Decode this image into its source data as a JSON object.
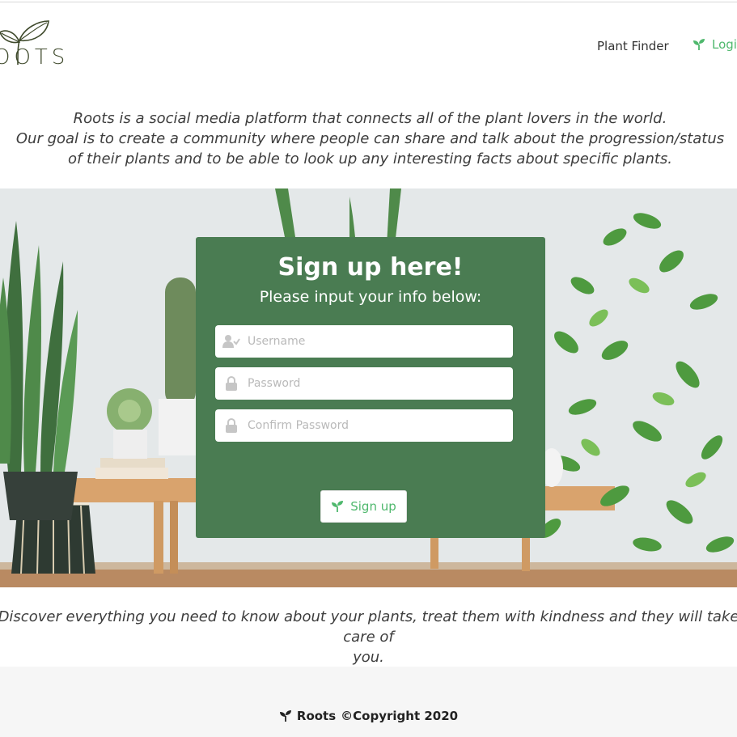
{
  "header": {
    "logo_text": "OOTS",
    "nav": {
      "plant_finder": "Plant Finder",
      "login": "Login"
    }
  },
  "intro": {
    "line1": "Roots is a social media platform that connects all of the plant lovers in the world.",
    "line2": "Our goal is to create a community where people can share and talk about the progression/status",
    "line3": "of their plants and to be able to look up any interesting facts about specific plants."
  },
  "signup": {
    "title": "Sign up here!",
    "subtitle": "Please input your info below:",
    "username_placeholder": "Username",
    "password_placeholder": "Password",
    "confirm_placeholder": "Confirm Password",
    "button_label": "Sign up"
  },
  "tagline": {
    "line1": "Discover everything you need to know about your plants, treat them with kindness and they will take care of",
    "line2": "you."
  },
  "footer": {
    "brand": "Roots",
    "copyright": "©Copyright 2020"
  },
  "colors": {
    "accent_green": "#4fb86d",
    "card_green": "#4a7c52",
    "logo_brown": "#3f4a2c"
  },
  "icons": {
    "logo": "seedling-leaves-icon",
    "login": "seedling-icon",
    "username": "user-check-icon",
    "password": "lock-icon",
    "signup": "seedling-icon",
    "footer": "seedling-icon"
  }
}
